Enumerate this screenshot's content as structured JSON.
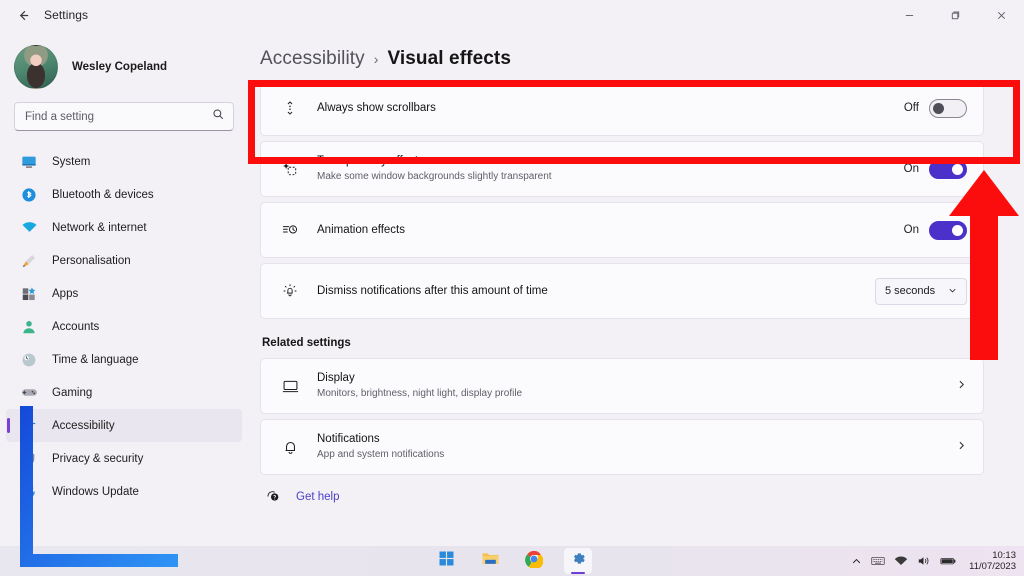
{
  "window": {
    "app_title": "Settings",
    "back_icon": "back-arrow-icon",
    "minimize_label": "—",
    "maximize_label": "❐",
    "close_label": "✕"
  },
  "sidebar": {
    "profile_name": "Wesley Copeland",
    "search": {
      "placeholder": "Find a setting",
      "value": "",
      "icon": "search-icon"
    },
    "items": [
      {
        "label": "System",
        "icon": "monitor-icon",
        "active": false
      },
      {
        "label": "Bluetooth & devices",
        "icon": "bluetooth-icon",
        "active": false
      },
      {
        "label": "Network & internet",
        "icon": "wifi-icon",
        "active": false
      },
      {
        "label": "Personalisation",
        "icon": "paintbrush-icon",
        "active": false
      },
      {
        "label": "Apps",
        "icon": "apps-icon",
        "active": false
      },
      {
        "label": "Accounts",
        "icon": "person-icon",
        "active": false
      },
      {
        "label": "Time & language",
        "icon": "clock-globe-icon",
        "active": false
      },
      {
        "label": "Gaming",
        "icon": "gamepad-icon",
        "active": false
      },
      {
        "label": "Accessibility",
        "icon": "accessibility-icon",
        "active": true
      },
      {
        "label": "Privacy & security",
        "icon": "shield-lock-icon",
        "active": false
      },
      {
        "label": "Windows Update",
        "icon": "update-icon",
        "active": false
      }
    ]
  },
  "main": {
    "breadcrumb": {
      "parent": "Accessibility",
      "separator": "›",
      "current": "Visual effects"
    },
    "settings": [
      {
        "title": "Always show scrollbars",
        "subtitle": "",
        "icon": "scrollbar-icon",
        "control": "toggle",
        "state_label": "Off",
        "state": "off"
      },
      {
        "title": "Transparency effects",
        "subtitle": "Make some window backgrounds slightly transparent",
        "icon": "transparency-icon",
        "control": "toggle",
        "state_label": "On",
        "state": "on"
      },
      {
        "title": "Animation effects",
        "subtitle": "",
        "icon": "animation-icon",
        "control": "toggle",
        "state_label": "On",
        "state": "on"
      },
      {
        "title": "Dismiss notifications after this amount of time",
        "subtitle": "",
        "icon": "notification-timer-icon",
        "control": "dropdown",
        "state_label": "5 seconds",
        "state": "dropdown"
      }
    ],
    "related": {
      "section_title": "Related settings",
      "items": [
        {
          "title": "Display",
          "subtitle": "Monitors, brightness, night light, display profile",
          "icon": "display-icon",
          "chevron": "chevron-right-icon"
        },
        {
          "title": "Notifications",
          "subtitle": "App and system notifications",
          "icon": "bell-icon",
          "chevron": "chevron-right-icon"
        }
      ]
    },
    "get_help": {
      "label": "Get help",
      "icon": "help-icon"
    }
  },
  "taskbar": {
    "buttons": [
      {
        "name": "start-button",
        "icon": "windows-logo-icon",
        "active": false
      },
      {
        "name": "file-explorer-button",
        "icon": "folder-icon",
        "active": false
      },
      {
        "name": "chrome-button",
        "icon": "chrome-icon",
        "active": false
      },
      {
        "name": "settings-button",
        "icon": "gear-icon",
        "active": true
      }
    ],
    "tray": {
      "overflow_icon": "chevron-up-icon",
      "keyboard_icon": "keyboard-icon",
      "wifi_icon": "wifi-icon",
      "volume_icon": "speaker-icon",
      "battery_icon": "battery-icon",
      "time": "10:13",
      "date": "11/07/2023"
    }
  },
  "annotations": {
    "highlight_rect_color": "#fc0d0d",
    "arrow_color": "#fc0d0d",
    "bracket_color": "#1a74e8"
  }
}
